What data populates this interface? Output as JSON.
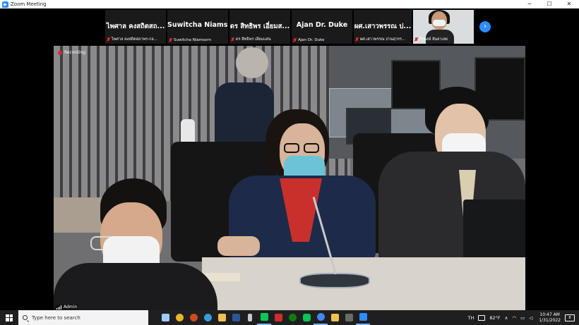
{
  "window": {
    "title": "Zoom Meeting",
    "minimize": "─",
    "maximize": "☐",
    "close": "✕"
  },
  "gallery": {
    "tiles": [
      {
        "big": "ไพศาล คงสถิตสถ...",
        "small": "ไพศาล คงสถิตสถาพร-กอ..."
      },
      {
        "big": "Suwitcha  Niams...",
        "small": "Suwitcha Niamsorn"
      },
      {
        "big": "ดร สิทธิพร เอี่ยมส...",
        "small": "ดร สิทธิพร เอี่ยมแสน"
      },
      {
        "big": "Ajan Dr. Duke",
        "small": "Ajan Dr. Duke"
      },
      {
        "big": "ผศ.เสาวพรรณ ป...",
        "small": "ผศ.เสาวพรรณ ปานสุวรร..."
      }
    ],
    "video_tile_name": "ธีรพงษ์ จันลาเลย",
    "next": "›"
  },
  "main_video": {
    "recording": "Recording",
    "participant": "Admin"
  },
  "taskbar": {
    "search_placeholder": "Type here to search",
    "lang": "TH",
    "temperature": "82°F",
    "time": "10:47 AM",
    "date": "1/31/2022",
    "notifications": "8",
    "colors": {
      "zoom_blue": "#2d8cff",
      "mute_red": "#e02828",
      "taskbar": "#1f1f1f"
    }
  }
}
